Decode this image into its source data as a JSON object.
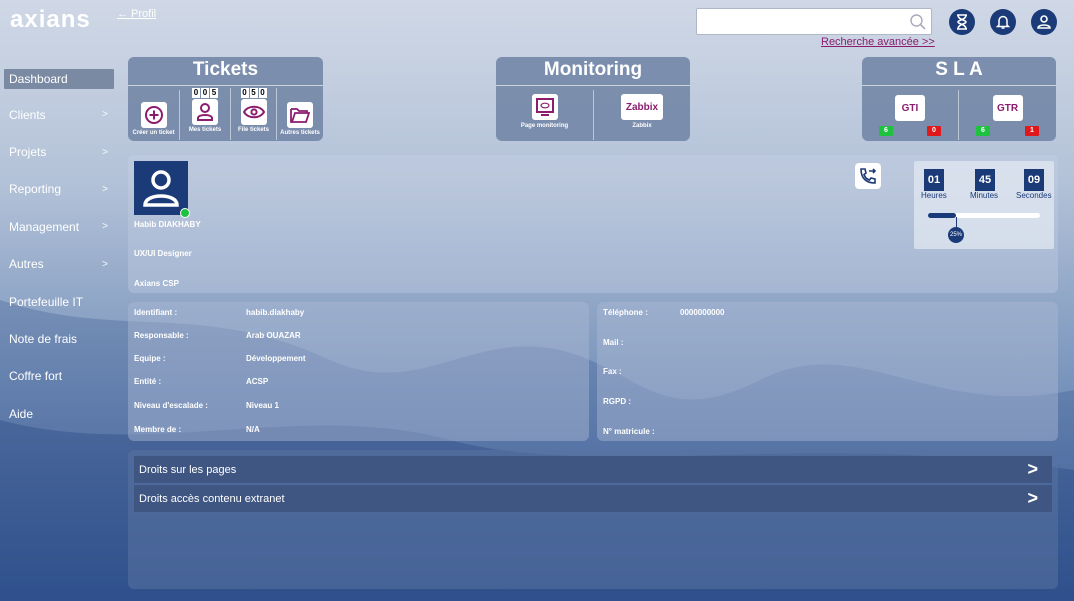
{
  "header": {
    "logo": "axians",
    "back_link": "← Profil",
    "search_placeholder": "",
    "advanced_search": "Recherche avancée >>"
  },
  "sidebar": {
    "items": [
      {
        "label": "Dashboard",
        "chevron": ""
      },
      {
        "label": "Clients",
        "chevron": ">"
      },
      {
        "label": "Projets",
        "chevron": ">"
      },
      {
        "label": "Reporting",
        "chevron": ">"
      },
      {
        "label": "Management",
        "chevron": ">"
      },
      {
        "label": "Autres",
        "chevron": ">"
      },
      {
        "label": "Portefeuille IT",
        "chevron": ""
      },
      {
        "label": "Note de frais",
        "chevron": ""
      },
      {
        "label": "Coffre fort",
        "chevron": ""
      },
      {
        "label": "Aide",
        "chevron": ""
      }
    ]
  },
  "tickets": {
    "title": "Tickets",
    "create": "Créer un ticket",
    "mine": "Mes tickets",
    "mine_count": [
      "0",
      "0",
      "5"
    ],
    "queue": "File tickets",
    "queue_count": [
      "0",
      "5",
      "0"
    ],
    "others": "Autres tickets"
  },
  "monitoring": {
    "title": "Monitoring",
    "page": "Page monitoring",
    "zabbix_logo": "Zabbix",
    "zabbix": "Zabbix"
  },
  "sla": {
    "title": "S L A",
    "gti": "GTI",
    "gti_ok": "6",
    "gti_ko": "0",
    "gtr": "GTR",
    "gtr_ok": "6",
    "gtr_ko": "1"
  },
  "profile": {
    "name": "Habib DIAKHABY",
    "role": "UX/UI Designer",
    "company": "Axians CSP"
  },
  "timer": {
    "hours": "01",
    "hours_label": "Heures",
    "minutes": "45",
    "minutes_label": "Minutes",
    "seconds": "09",
    "seconds_label": "Secondes",
    "progress_label": "25%",
    "progress": 0.25
  },
  "details_left": [
    {
      "label": "Identifiant :",
      "value": "habib.diakhaby"
    },
    {
      "label": "Responsable :",
      "value": "Arab OUAZAR"
    },
    {
      "label": "Equipe :",
      "value": "Développement"
    },
    {
      "label": "Entité :",
      "value": "ACSP"
    },
    {
      "label": "Niveau d'escalade :",
      "value": "Niveau 1"
    },
    {
      "label": "Membre de :",
      "value": "N/A"
    }
  ],
  "details_right": [
    {
      "label": "Téléphone :",
      "value": "0000000000"
    },
    {
      "label": "Mail :",
      "value": ""
    },
    {
      "label": "Fax :",
      "value": ""
    },
    {
      "label": "RGPD :",
      "value": ""
    },
    {
      "label": "N° matricule :",
      "value": ""
    }
  ],
  "rights": [
    {
      "label": "Droits sur les pages",
      "arrow": ">"
    },
    {
      "label": "Droits accès contenu extranet",
      "arrow": ">"
    }
  ],
  "colors": {
    "accent": "#8a1d6e",
    "navy": "#1b3a78",
    "panel": "#6e82a3",
    "ok": "#1fc23f",
    "ko": "#e0181b"
  }
}
